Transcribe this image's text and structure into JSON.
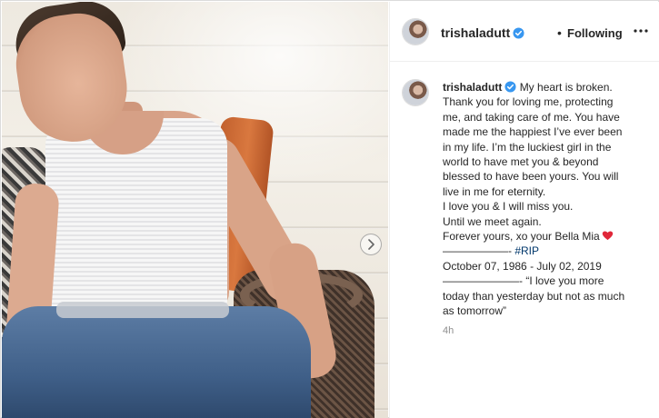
{
  "post": {
    "image": {
      "description_icon": "photo-of-man-in-white-tank-top-on-wicker-chair",
      "next_icon": "chevron-right-icon"
    },
    "header": {
      "username": "trishaladutt",
      "separator": "•",
      "follow_status": "Following",
      "more_icon": "ellipsis-icon"
    },
    "caption": {
      "username": "trishaladutt",
      "first_line": "My heart is broken.",
      "lines": [
        "Thank you for loving me, protecting",
        "me, and taking care of me. You have",
        "made me the happiest I’ve ever been",
        "in my life. I’m the luckiest girl in the",
        "world to have met you & beyond",
        "blessed to have been yours. You will",
        "live in me for eternity.",
        "I love you & I will miss you.",
        "Until we meet again."
      ],
      "signoff": "Forever yours, xo your Bella Mia",
      "divider1": "——————-",
      "hashtag": "#RIP",
      "dates": "October 07, 1986 - July 02, 2019",
      "divider2": "———————-",
      "quote_lines": [
        "“I love you more",
        "today than yesterday but not as much",
        "as tomorrow”"
      ]
    },
    "timestamp": "4h"
  },
  "colors": {
    "verified_blue": "#3897f0",
    "heart_red": "#ed4956",
    "hashtag_blue": "#00376b",
    "muted_gray": "#8e8e8e"
  }
}
